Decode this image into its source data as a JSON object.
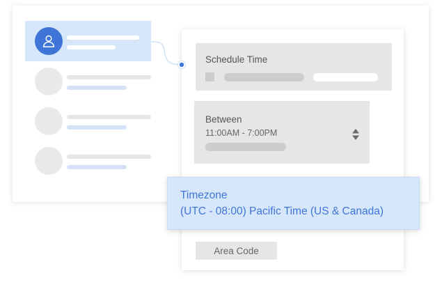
{
  "schedule": {
    "label": "Schedule Time"
  },
  "between": {
    "label": "Between",
    "value": "11:00AM - 7:00PM"
  },
  "timezone": {
    "label": "Timezone",
    "value": "(UTC - 08:00) Pacific Time (US & Canada)"
  },
  "area_code": {
    "label": "Area Code"
  },
  "colors": {
    "accent": "#3e75d6",
    "selected_bg": "#d7e7fb",
    "placeholder_gray": "#e6e6e6"
  },
  "icons": {
    "avatar": "user-icon",
    "sort": "sort-arrows-icon"
  }
}
